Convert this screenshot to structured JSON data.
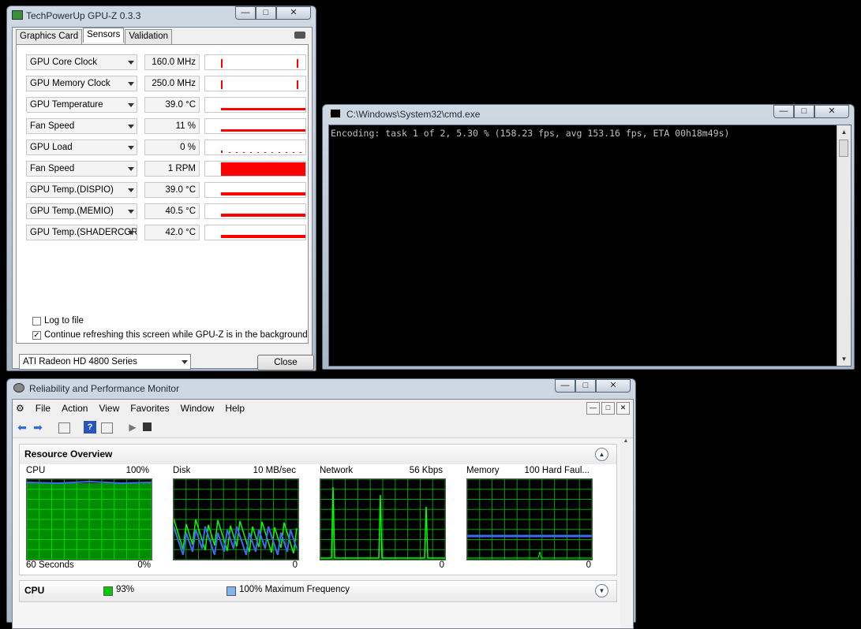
{
  "gpuz": {
    "title": "TechPowerUp GPU-Z 0.3.3",
    "tabs": [
      "Graphics Card",
      "Sensors",
      "Validation"
    ],
    "sensors": [
      {
        "name": "GPU Core Clock",
        "value": "160.0 MHz"
      },
      {
        "name": "GPU Memory Clock",
        "value": "250.0 MHz"
      },
      {
        "name": "GPU Temperature",
        "value": "39.0 °C"
      },
      {
        "name": "Fan Speed",
        "value": "11 %"
      },
      {
        "name": "GPU Load",
        "value": "0 %"
      },
      {
        "name": "Fan Speed",
        "value": "1 RPM"
      },
      {
        "name": "GPU Temp.(DISPIO)",
        "value": "39.0 °C"
      },
      {
        "name": "GPU Temp.(MEMIO)",
        "value": "40.5 °C"
      },
      {
        "name": "GPU Temp.(SHADERCORE)",
        "value": "42.0 °C"
      }
    ],
    "log_label": "Log to file",
    "refresh_label": "Continue refreshing this screen while GPU-Z is in the background",
    "gpu_select": "ATI Radeon HD 4800 Series",
    "close_label": "Close",
    "graph_color": "#ff0000"
  },
  "cmd": {
    "title": "C:\\Windows\\System32\\cmd.exe",
    "output": "Encoding: task 1 of 2, 5.30 % (158.23 fps, avg 153.16 fps, ETA 00h18m49s)"
  },
  "perf": {
    "title": "Reliability and Performance Monitor",
    "menu": [
      "File",
      "Action",
      "View",
      "Favorites",
      "Window",
      "Help"
    ],
    "resource_overview": "Resource Overview",
    "graphs": [
      {
        "label": "CPU",
        "max": "100%",
        "bottom_left": "60 Seconds",
        "bottom_right": "0%"
      },
      {
        "label": "Disk",
        "max": "10 MB/sec",
        "bottom_left": "",
        "bottom_right": "0"
      },
      {
        "label": "Network",
        "max": "56 Kbps",
        "bottom_left": "",
        "bottom_right": "0"
      },
      {
        "label": "Memory",
        "max": "100 Hard Faul...",
        "bottom_left": "",
        "bottom_right": "0"
      }
    ],
    "cpu_section": {
      "title": "CPU",
      "usage": "93%",
      "freq": "100% Maximum Frequency",
      "usage_color": "#00cc00",
      "freq_color": "#7fb6f0"
    },
    "grid_color": "#00a000",
    "line_green": "#00ff00",
    "line_blue": "#3a6cf0"
  },
  "caption": {
    "min": "—",
    "max": "□",
    "close": "✕"
  }
}
